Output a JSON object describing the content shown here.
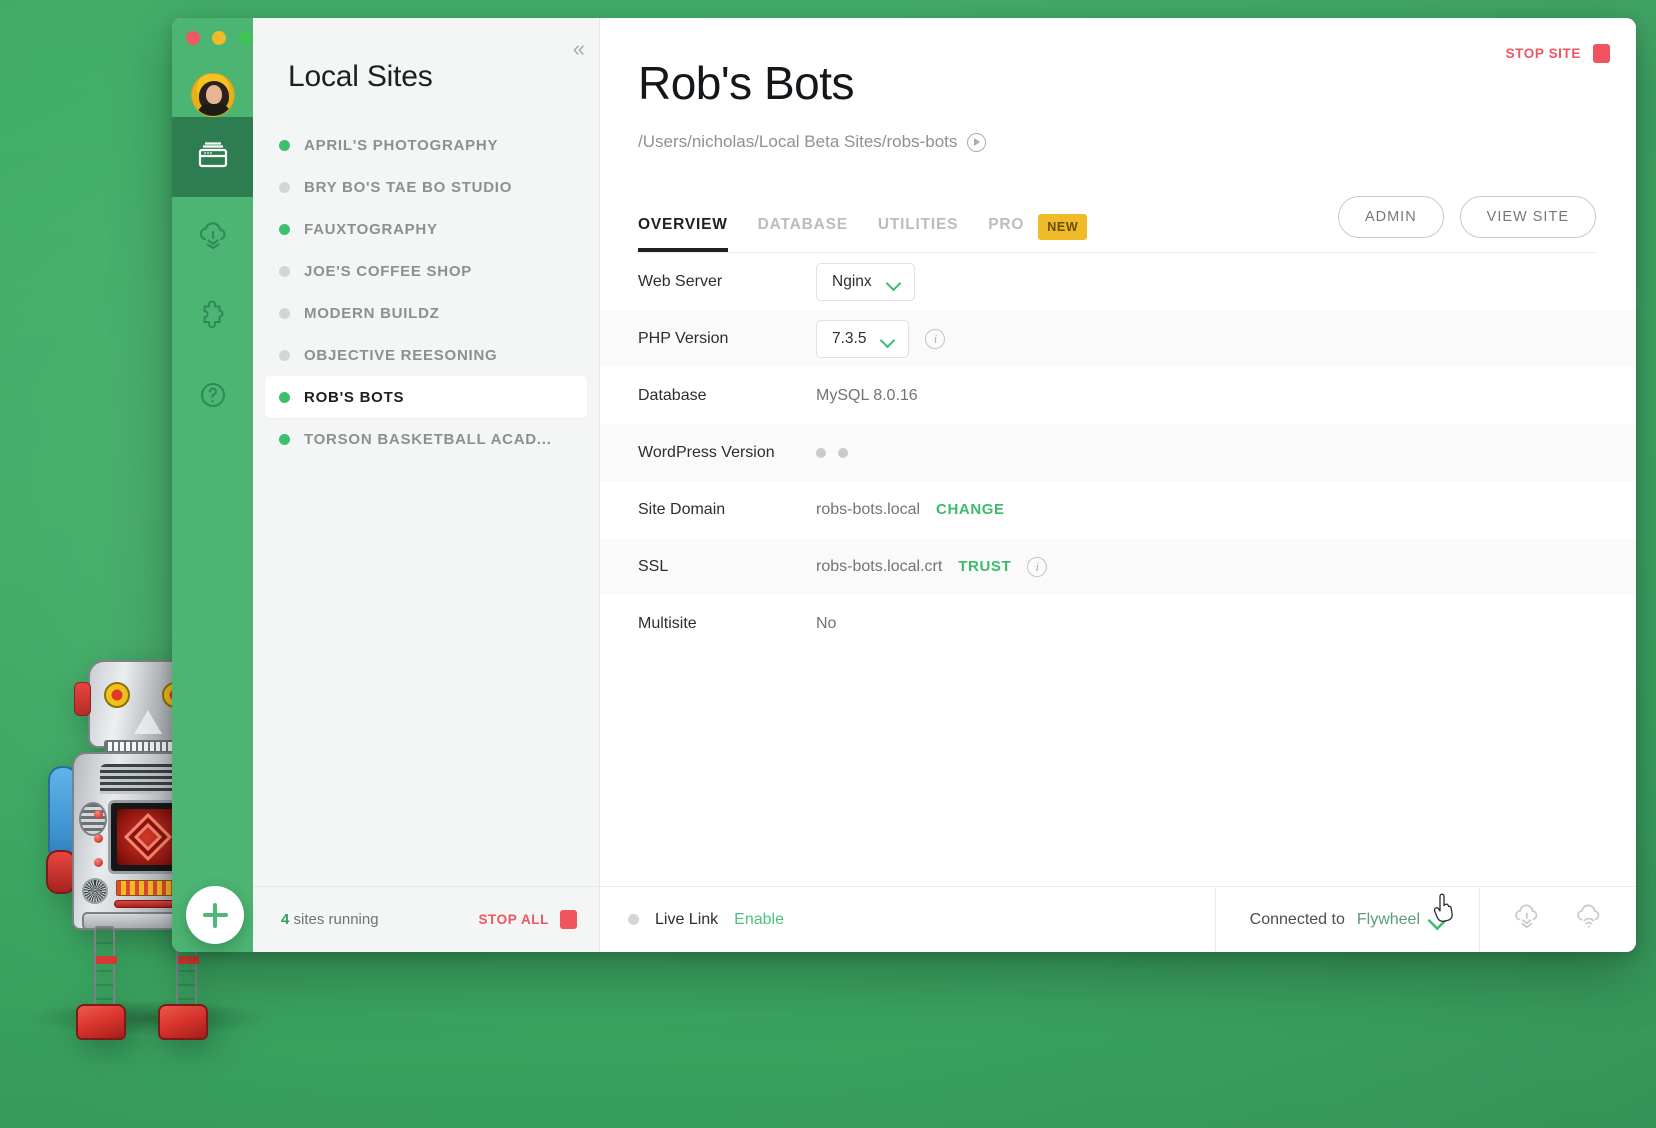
{
  "window": {
    "traffic_lights": [
      "close",
      "minimize",
      "maximize"
    ]
  },
  "rail": {
    "items": [
      {
        "name": "sites",
        "icon": "sites-icon",
        "active": true
      },
      {
        "name": "cloud-backups",
        "icon": "cloud-icon",
        "active": false
      },
      {
        "name": "add-ons",
        "icon": "puzzle-icon",
        "active": false
      },
      {
        "name": "help",
        "icon": "question-icon",
        "active": false
      }
    ]
  },
  "sidebar": {
    "title": "Local Sites",
    "collapse_icon": "chevron-double-left-icon",
    "sites": [
      {
        "name": "APRIL'S PHOTOGRAPHY",
        "running": true,
        "selected": false
      },
      {
        "name": "BRY BO'S TAE BO STUDIO",
        "running": false,
        "selected": false
      },
      {
        "name": "FAUXTOGRAPHY",
        "running": true,
        "selected": false
      },
      {
        "name": "JOE'S COFFEE SHOP",
        "running": false,
        "selected": false
      },
      {
        "name": "MODERN BUILDZ",
        "running": false,
        "selected": false
      },
      {
        "name": "OBJECTIVE REESONING",
        "running": false,
        "selected": false
      },
      {
        "name": "ROB'S BOTS",
        "running": true,
        "selected": true
      },
      {
        "name": "TORSON BASKETBALL ACAD...",
        "running": true,
        "selected": false
      }
    ],
    "footer": {
      "running_count": "4",
      "running_label": "sites running",
      "stop_all_label": "STOP ALL"
    }
  },
  "main": {
    "stop_site_label": "STOP SITE",
    "site_title": "Rob's Bots",
    "site_path": "/Users/nicholas/Local Beta Sites/robs-bots",
    "tabs": [
      {
        "label": "OVERVIEW",
        "active": true
      },
      {
        "label": "DATABASE",
        "active": false
      },
      {
        "label": "UTILITIES",
        "active": false
      },
      {
        "label": "PRO",
        "active": false
      }
    ],
    "pro_badge": "NEW",
    "actions": [
      {
        "label": "ADMIN"
      },
      {
        "label": "VIEW SITE"
      }
    ],
    "rows": [
      {
        "key": "Web Server",
        "type": "select",
        "value": "Nginx"
      },
      {
        "key": "PHP Version",
        "type": "select",
        "value": "7.3.5",
        "info": true
      },
      {
        "key": "Database",
        "type": "text",
        "value": "MySQL 8.0.16"
      },
      {
        "key": "WordPress Version",
        "type": "loading",
        "value": ""
      },
      {
        "key": "Site Domain",
        "type": "text",
        "value": "robs-bots.local",
        "action": "CHANGE"
      },
      {
        "key": "SSL",
        "type": "text",
        "value": "robs-bots.local.crt",
        "action": "TRUST",
        "info": true
      },
      {
        "key": "Multisite",
        "type": "text",
        "value": "No"
      }
    ]
  },
  "bottombar": {
    "live_link_label": "Live Link",
    "live_link_action": "Enable",
    "connected_prefix": "Connected to",
    "connected_service": "Flywheel",
    "icons": [
      {
        "name": "cloud-pull-icon"
      },
      {
        "name": "cloud-push-icon"
      }
    ]
  },
  "fab": {
    "label": "+",
    "name": "add-site-button"
  },
  "colors": {
    "desktop_green": "#3faa65",
    "rail_green": "#4cb573",
    "rail_active_green": "#2e7d50",
    "accent_green": "#3dbb6d",
    "danger_red": "#ef5562",
    "badge_yellow": "#f0bb29"
  }
}
